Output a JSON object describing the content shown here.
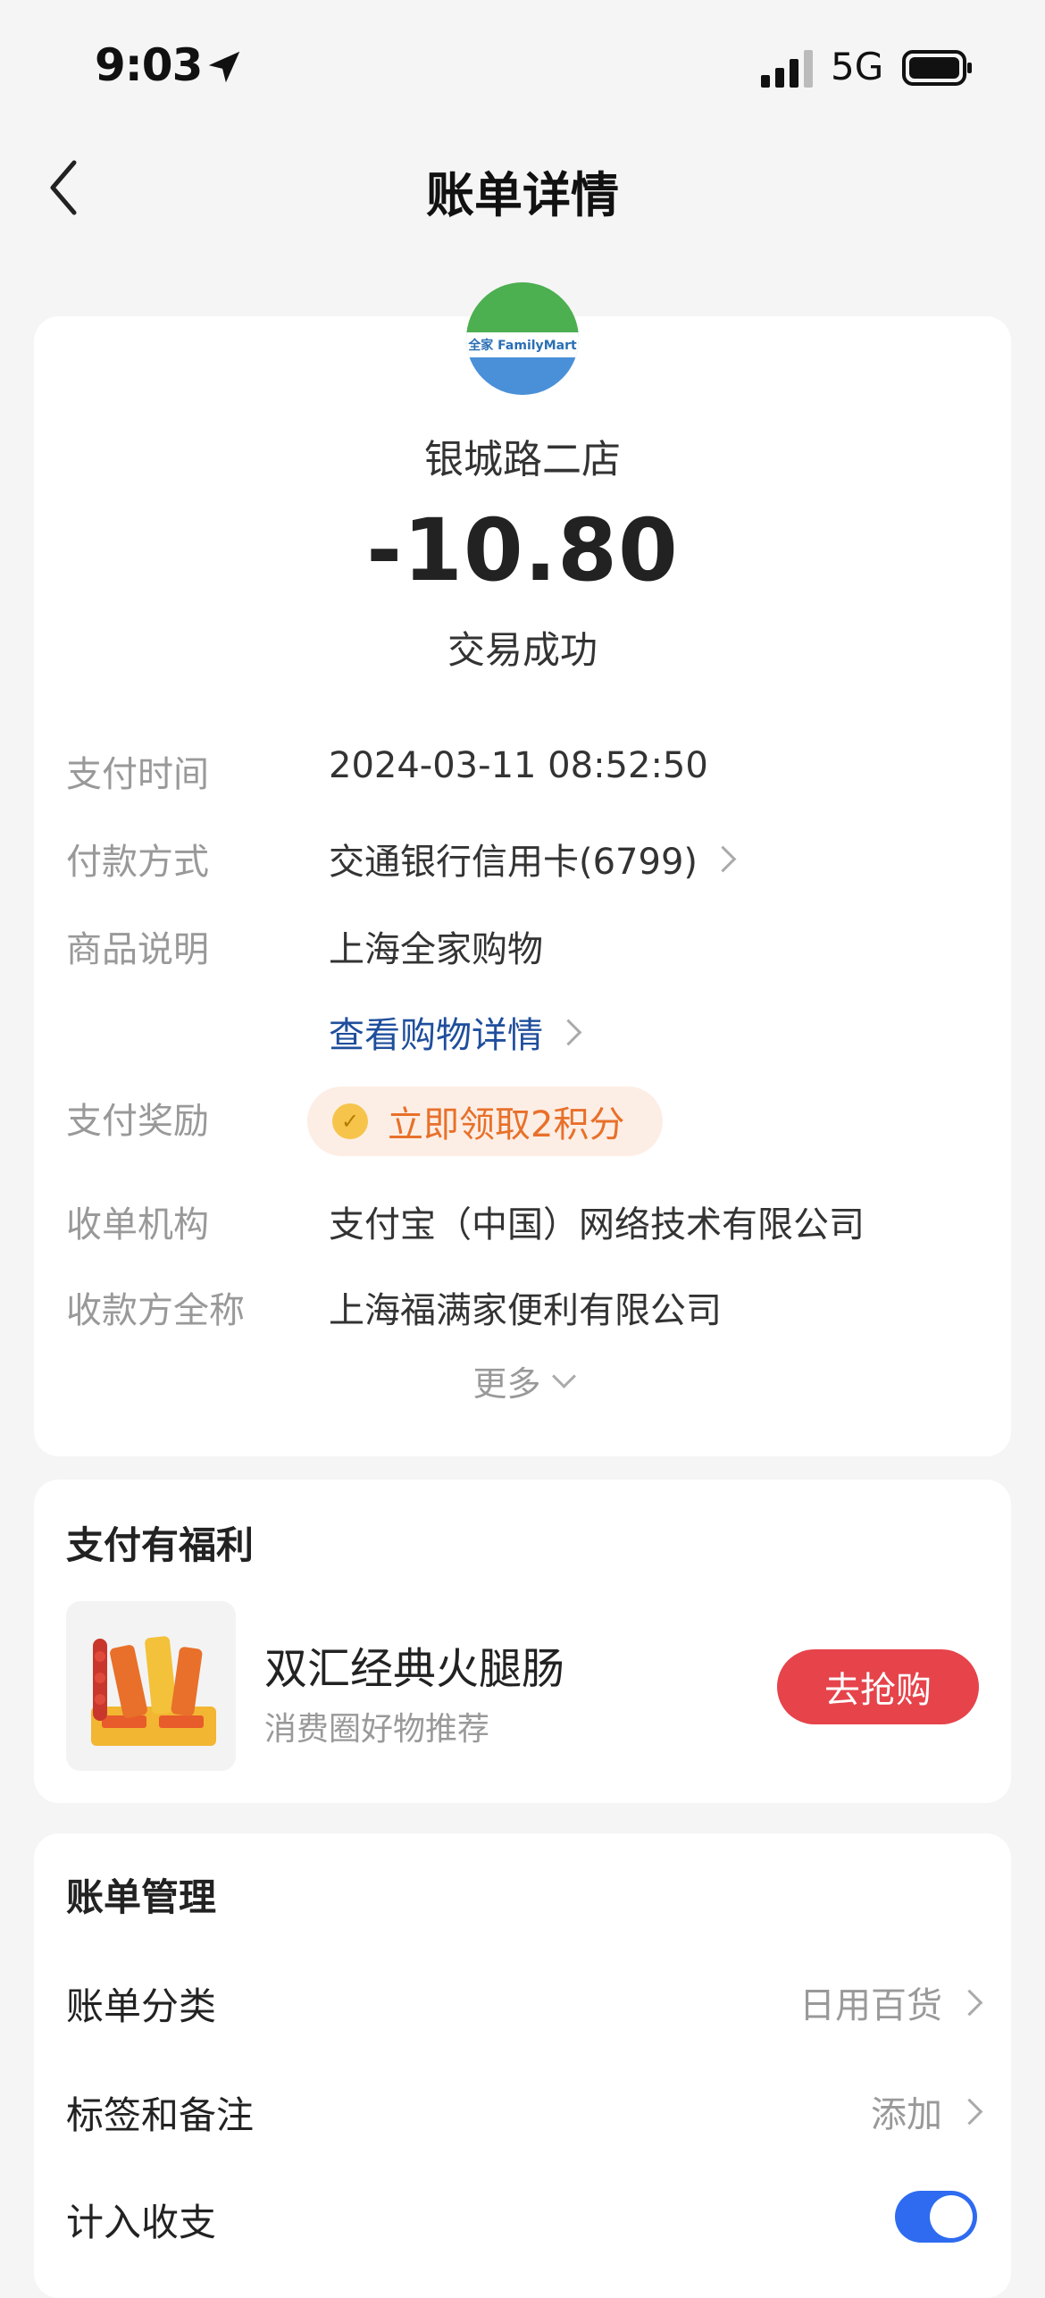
{
  "status_bar": {
    "time": "9:03",
    "network": "5G"
  },
  "nav": {
    "title": "账单详情"
  },
  "summary": {
    "merchant_logo_text": "全家 FamilyMart",
    "merchant_name": "银城路二店",
    "amount": "-10.80",
    "status": "交易成功"
  },
  "details": {
    "pay_time_label": "支付时间",
    "pay_time_value": "2024-03-11 08:52:50",
    "pay_method_label": "付款方式",
    "pay_method_value": "交通银行信用卡(6799)",
    "goods_label": "商品说明",
    "goods_value": "上海全家购物",
    "goods_link": "查看购物详情",
    "reward_label": "支付奖励",
    "reward_value": "立即领取2积分",
    "acquirer_label": "收单机构",
    "acquirer_value": "支付宝（中国）网络技术有限公司",
    "payee_label": "收款方全称",
    "payee_value": "上海福满家便利有限公司",
    "more_label": "更多"
  },
  "benefits": {
    "title": "支付有福利",
    "product_name": "双汇经典火腿肠",
    "product_sub": "消费圈好物推荐",
    "button_label": "去抢购"
  },
  "management": {
    "title": "账单管理",
    "category_label": "账单分类",
    "category_value": "日用百货",
    "tag_label": "标签和备注",
    "tag_value": "添加",
    "count_label": "计入收支",
    "count_enabled": true
  },
  "colors": {
    "accent_blue": "#2e6bf0",
    "buy_red": "#e6434b",
    "reward_orange": "#e8702a",
    "link_blue": "#1f4e9c"
  }
}
